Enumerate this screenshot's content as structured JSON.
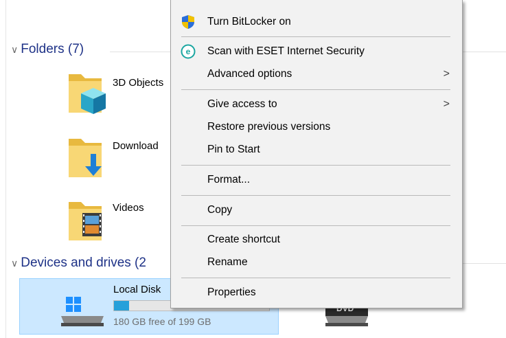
{
  "explorer": {
    "folders_group": {
      "label": "Folders (7)"
    },
    "folders": [
      {
        "label": "3D Objects",
        "icon": "3d-objects-folder-icon"
      },
      {
        "label": "Download",
        "icon": "downloads-folder-icon"
      },
      {
        "label": "Videos",
        "icon": "videos-folder-icon"
      }
    ],
    "devices_group": {
      "label": "Devices and drives (2"
    },
    "drive": {
      "label": "Local Disk",
      "free_text": "180 GB free of 199 GB",
      "used_fraction": 0.096,
      "bar_color": "#26a0da"
    },
    "dvd": {
      "label": "DVD"
    }
  },
  "context_menu": {
    "items": [
      {
        "label": "Turn BitLocker on",
        "icon": "bitlocker-shield-icon"
      },
      {
        "label": "Scan with ESET Internet Security",
        "icon": "eset-icon"
      },
      {
        "label": "Advanced options",
        "submenu": true
      },
      {
        "label": "Give access to",
        "submenu": true
      },
      {
        "label": "Restore previous versions"
      },
      {
        "label": "Pin to Start"
      },
      {
        "label": "Format..."
      },
      {
        "label": "Copy"
      },
      {
        "label": "Create shortcut"
      },
      {
        "label": "Rename"
      },
      {
        "label": "Properties"
      }
    ],
    "submenu_arrow": ">"
  },
  "colors": {
    "group_header": "#1e3287",
    "selection": "#cce8ff",
    "menu_bg": "#f2f2f2"
  }
}
